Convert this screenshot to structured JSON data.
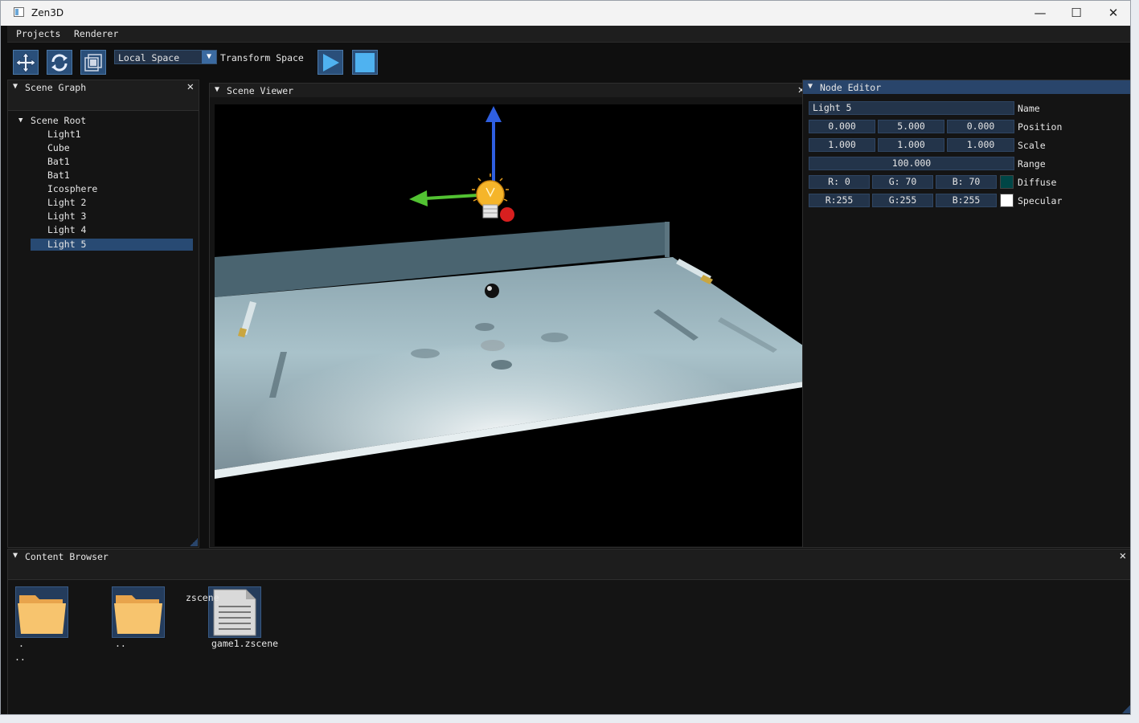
{
  "window": {
    "title": "Zen3D",
    "minimize_glyph": "—",
    "maximize_glyph": "☐",
    "close_glyph": "✕"
  },
  "menu": {
    "items": [
      "Projects",
      "Renderer"
    ]
  },
  "toolbar": {
    "move_icon": "move-arrows-icon",
    "rotate_icon": "rotate-icon",
    "scale_icon": "scale-icon",
    "space_select": "Local Space",
    "space_label": "Transform Space",
    "play_icon": "play-icon",
    "stop_icon": "stop-icon"
  },
  "scene_graph": {
    "title": "Scene Graph",
    "root": "Scene Root",
    "items": [
      "Light1",
      "Cube",
      "Bat1",
      "Bat1",
      "Icosphere",
      "Light 2",
      "Light 3",
      "Light 4",
      "Light 5"
    ],
    "selected": "Light 5"
  },
  "scene_viewer": {
    "title": "Scene Viewer"
  },
  "node_editor": {
    "title": "Node Editor",
    "name_value": "Light 5",
    "name_label": "Name",
    "position": [
      "0.000",
      "5.000",
      "0.000"
    ],
    "position_label": "Position",
    "scale": [
      "1.000",
      "1.000",
      "1.000"
    ],
    "scale_label": "Scale",
    "range": "100.000",
    "range_label": "Range",
    "diffuse": [
      "R:  0",
      "G: 70",
      "B: 70"
    ],
    "diffuse_label": "Diffuse",
    "diffuse_color": "#004646",
    "specular": [
      "R:255",
      "G:255",
      "B:255"
    ],
    "specular_label": "Specular",
    "specular_color": "#ffffff"
  },
  "content_browser": {
    "title": "Content Browser",
    "items": [
      {
        "type": "folder",
        "label": "."
      },
      {
        "type": "folder",
        "label": ".."
      },
      {
        "type": "file",
        "label": "game1.zscene",
        "tag": "zscene"
      }
    ],
    "extra": ".."
  },
  "colors": {
    "accent": "#29456b",
    "selection": "#284a73",
    "field": "#23344a"
  }
}
